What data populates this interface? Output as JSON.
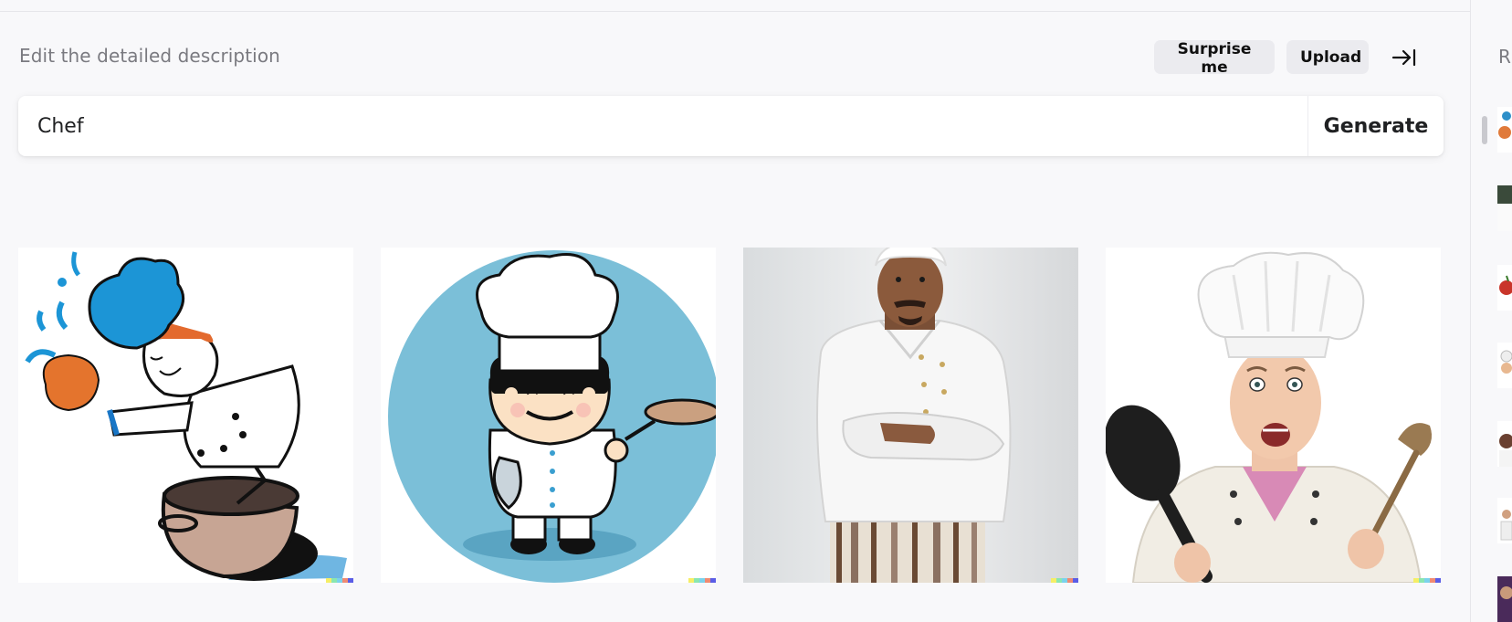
{
  "create": {
    "subtitle": "Edit the detailed description",
    "surprise_label": "Surprise me",
    "upload_label": "Upload",
    "collapse_icon": "arrow-right-to-line-icon",
    "prompt_value": "Chef",
    "generate_label": "Generate"
  },
  "results": [
    {
      "description": "cartoon chef splashing pot"
    },
    {
      "description": "cartoon chef with mustache in blue circle"
    },
    {
      "description": "photo of chef with arms crossed"
    },
    {
      "description": "photo of surprised chef holding spoons"
    }
  ],
  "history": {
    "title": "R",
    "item_count": 8
  },
  "colors": {
    "background": "#f8f8fa",
    "button_bg": "#ebebef",
    "text": "#202123",
    "muted_text": "#7a7a80"
  }
}
